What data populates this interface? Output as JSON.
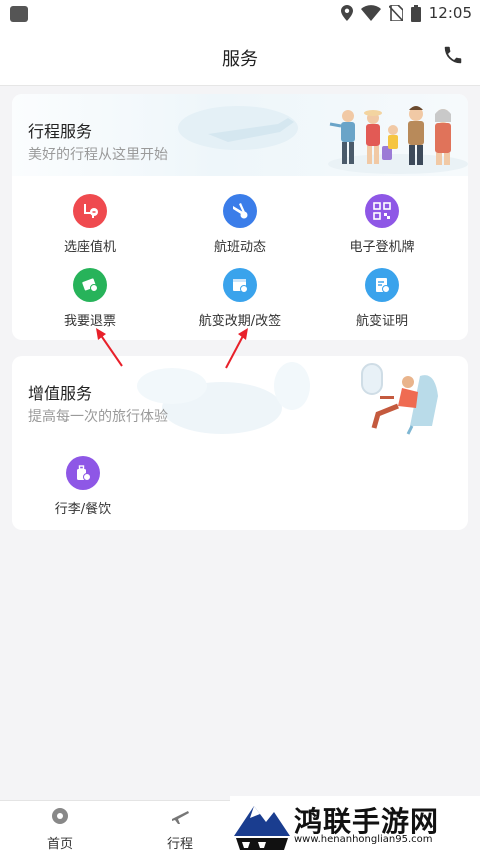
{
  "status_bar": {
    "time": "12:05",
    "icons": [
      "location-icon",
      "wifi-icon",
      "no-sim-icon",
      "battery-icon"
    ]
  },
  "header": {
    "title": "服务",
    "action_icon": "phone-icon"
  },
  "trip_services": {
    "title": "行程服务",
    "subtitle": "美好的行程从这里开始",
    "items": [
      {
        "label": "选座值机",
        "icon": "seat-icon",
        "color": "#ef4a4f"
      },
      {
        "label": "航班动态",
        "icon": "plane-status-icon",
        "color": "#3b7de9"
      },
      {
        "label": "电子登机牌",
        "icon": "qr-code-icon",
        "color": "#8e57e6"
      },
      {
        "label": "我要退票",
        "icon": "refund-ticket-icon",
        "color": "#27b35a"
      },
      {
        "label": "航变改期/改签",
        "icon": "reschedule-icon",
        "color": "#3aa3ec"
      },
      {
        "label": "航变证明",
        "icon": "certificate-icon",
        "color": "#3aa3ec"
      }
    ]
  },
  "value_added_services": {
    "title": "增值服务",
    "subtitle": "提高每一次的旅行体验",
    "items": [
      {
        "label": "行李/餐饮",
        "icon": "luggage-icon",
        "color": "#8e57e6"
      }
    ]
  },
  "bottom_nav": {
    "items": [
      {
        "label": "首页",
        "icon": "home-icon"
      },
      {
        "label": "行程",
        "icon": "plane-icon"
      }
    ]
  },
  "watermark": {
    "text": "鸿联手游网",
    "url": "www.henanhonglian95.com"
  },
  "colors": {
    "accent_red": "#e8202a",
    "background": "#f4f4f6"
  }
}
